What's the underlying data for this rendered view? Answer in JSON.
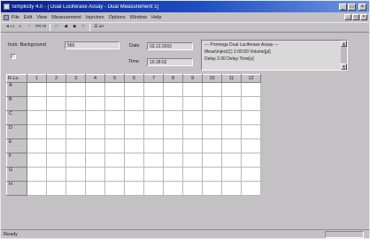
{
  "window": {
    "title": "Simplicity 4.0 - [ Dual Luciferase Assay - Dual Measurement 1]",
    "minimize": "_",
    "maximize": "□",
    "close": "×"
  },
  "menu": {
    "items": [
      "File",
      "Edit",
      "View",
      "Measurement",
      "Injectors",
      "Options",
      "Window",
      "Help"
    ],
    "doc_minimize": "_",
    "doc_restore": "▭",
    "doc_close": "×"
  },
  "toolbar": {
    "tools": [
      "◄ Lt",
      "▶",
      "≡",
      "PR M",
      "□",
      "◀",
      "◆",
      "⇆",
      "☰ arr"
    ]
  },
  "info": {
    "background_label": "Instr. Background",
    "background_value": "565",
    "checkbox_label": "",
    "date_label": "Date",
    "date_value": "03.12.2002",
    "time_label": "Time",
    "time_value": "16:28:02",
    "notes": [
      "--- Promega Dual Luciferase Assay ---",
      "Meas\\Inject(1) 1:00:00 Volume[µl]",
      "Delay 2.00 Delay Time[s]"
    ]
  },
  "plate": {
    "corner_label": "R.Lu",
    "columns": [
      "1",
      "2",
      "3",
      "4",
      "5",
      "6",
      "7",
      "8",
      "9",
      "10",
      "11",
      "12"
    ],
    "rows": [
      "A",
      "B",
      "C",
      "D",
      "E",
      "F",
      "G",
      "H"
    ]
  },
  "status": {
    "text": "Ready"
  }
}
